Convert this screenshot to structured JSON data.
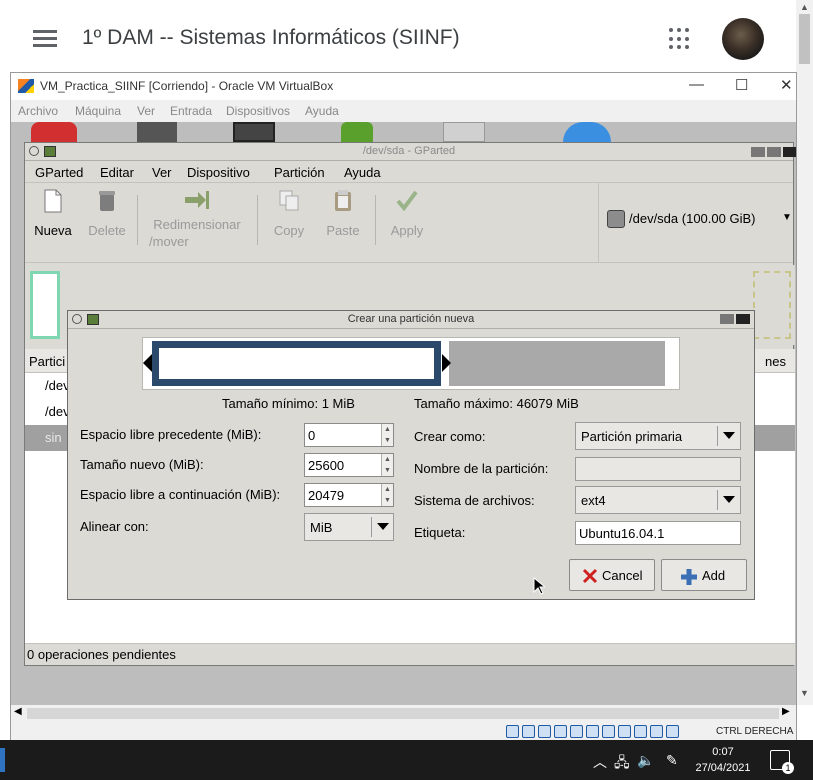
{
  "classroom": {
    "course_title": "1º DAM -- Sistemas Informáticos (SIINF)"
  },
  "vbox": {
    "title": "VM_Practica_SIINF [Corriendo] - Oracle VM VirtualBox",
    "menu": [
      "Archivo",
      "Máquina",
      "Ver",
      "Entrada",
      "Dispositivos",
      "Ayuda"
    ],
    "host_key": "CTRL DERECHA"
  },
  "gparted": {
    "title": "/dev/sda - GParted",
    "menu": [
      "GParted",
      "Editar",
      "Ver",
      "Dispositivo",
      "Partición",
      "Ayuda"
    ],
    "toolbar": {
      "new": "Nueva",
      "delete": "Delete",
      "resize_1": "Redimensionar",
      "resize_2": "/mover",
      "copy": "Copy",
      "paste": "Paste",
      "apply": "Apply"
    },
    "device": "/dev/sda  (100.00 GiB)",
    "list": {
      "col_partition": "Partici",
      "col_flags": "nes",
      "rows": [
        "/dev",
        "/dev",
        "sin"
      ]
    },
    "status": "0 operaciones pendientes"
  },
  "dialog": {
    "title": "Crear una partición nueva",
    "min_size": "Tamaño mínimo: 1 MiB",
    "max_size": "Tamaño máximo: 46079 MiB",
    "preceding_label": "Espacio libre precedente (MiB):",
    "preceding_value": "0",
    "new_size_label": "Tamaño nuevo (MiB):",
    "new_size_value": "25600",
    "following_label": "Espacio libre a continuación (MiB):",
    "following_value": "20479",
    "align_label": "Alinear con:",
    "align_value": "MiB",
    "create_as_label": "Crear como:",
    "create_as_value": "Partición primaria",
    "part_name_label": "Nombre de la partición:",
    "part_name_value": "",
    "fs_label": "Sistema de archivos:",
    "fs_value": "ext4",
    "tag_label": "Etiqueta:",
    "tag_value": "Ubuntu16.04.1",
    "cancel": "Cancel",
    "add": "Add",
    "used_fraction": 0.555
  },
  "taskbar": {
    "time": "0:07",
    "date": "27/04/2021",
    "notifications": "1"
  },
  "colors": {
    "partition_border": "#2b4a6b",
    "unallocated": "#a9a9a9",
    "selected_row": "#a0a0a0"
  }
}
